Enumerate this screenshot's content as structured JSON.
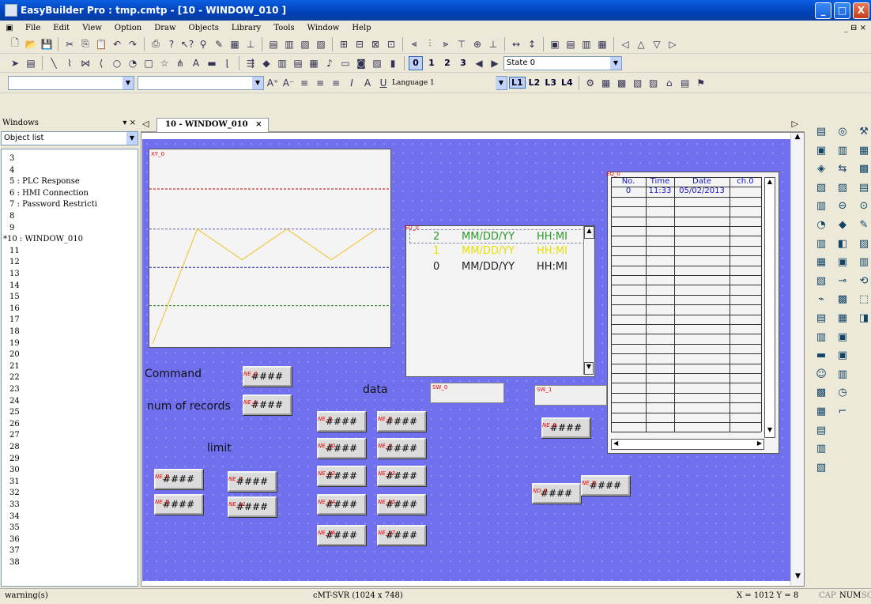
{
  "window": {
    "title": "EasyBuilder Pro : tmp.cmtp - [10 - WINDOW_010 ]",
    "minimize": "_",
    "maximize": "□",
    "close": "X"
  },
  "menu": [
    "File",
    "Edit",
    "View",
    "Option",
    "Draw",
    "Objects",
    "Library",
    "Tools",
    "Window",
    "Help"
  ],
  "menu_right": "_ ⊟ ×",
  "toolbar3": {
    "digits": [
      "0",
      "1",
      "2",
      "3"
    ],
    "state_value": "State 0"
  },
  "toolbar4": {
    "language_value": "Language 1",
    "layers": [
      "L1",
      "L2",
      "L3",
      "L4"
    ]
  },
  "left_panel": {
    "header": "Windows",
    "combo_value": "Object list",
    "items": [
      "3",
      "4",
      "5 : PLC Response",
      "6 : HMI Connection",
      "7 : Password Restricti",
      "8",
      "9",
      "*10 : WINDOW_010",
      "11",
      "12",
      "13",
      "14",
      "15",
      "16",
      "17",
      "18",
      "19",
      "20",
      "21",
      "22",
      "23",
      "24",
      "25",
      "26",
      "27",
      "28",
      "29",
      "30",
      "31",
      "32",
      "33",
      "34",
      "35",
      "36",
      "37",
      "38"
    ]
  },
  "tab": {
    "label": "10 - WINDOW_010"
  },
  "canvas": {
    "trend_tag": "XY_0",
    "history_tag": "ED_0",
    "table_tag": "EQ_0",
    "labels": {
      "command": "Command",
      "num_of_records": "num of records",
      "data": "data",
      "limit": "limit"
    },
    "history_rows": [
      {
        "num": "2",
        "date": "MM/DD/YY",
        "time": "HH:MI"
      },
      {
        "num": "1",
        "date": "MM/DD/YY",
        "time": "HH:MI"
      },
      {
        "num": "0",
        "date": "MM/DD/YY",
        "time": "HH:MI"
      }
    ],
    "table_headers": [
      "No.",
      "Time",
      "Date",
      "ch.0"
    ],
    "table_first_row": [
      "0",
      "11:33",
      "05/02/2013",
      ""
    ],
    "switch_tags": [
      "SW_0",
      "SW_1"
    ],
    "numeric_text": "####",
    "numeric_tags": [
      "NE_0",
      "NE_1",
      "NE_2",
      "NE_3",
      "NE_10",
      "NE_4",
      "NE_5",
      "NE_6",
      "NE_7",
      "NE_11",
      "NE_12",
      "NE_13",
      "NE_14",
      "NE_15",
      "NE_16",
      "NE_17",
      "NE_8",
      "ND_0",
      "NE_9"
    ]
  },
  "chart_data": {
    "type": "line",
    "x": [
      0,
      1,
      2,
      3,
      4,
      5
    ],
    "series": [
      {
        "values": [
          0,
          6,
          4.4,
          6,
          4.4,
          6
        ],
        "color": "#f0c020"
      }
    ],
    "ylim": [
      0,
      10
    ],
    "reference_lines": [
      {
        "value": 8.1,
        "color": "#c00000"
      },
      {
        "value": 6,
        "color": "#6060c0"
      },
      {
        "value": 4,
        "color": "#2020a0"
      },
      {
        "value": 2,
        "color": "#208020"
      }
    ],
    "grid": false
  },
  "status": {
    "left": "warning(s)",
    "middle": "cMT-SVR (1024 x 748)",
    "coords": "X = 1012  Y = 8",
    "caps": "CAP",
    "num": "NUM",
    "scroll": "SC"
  }
}
